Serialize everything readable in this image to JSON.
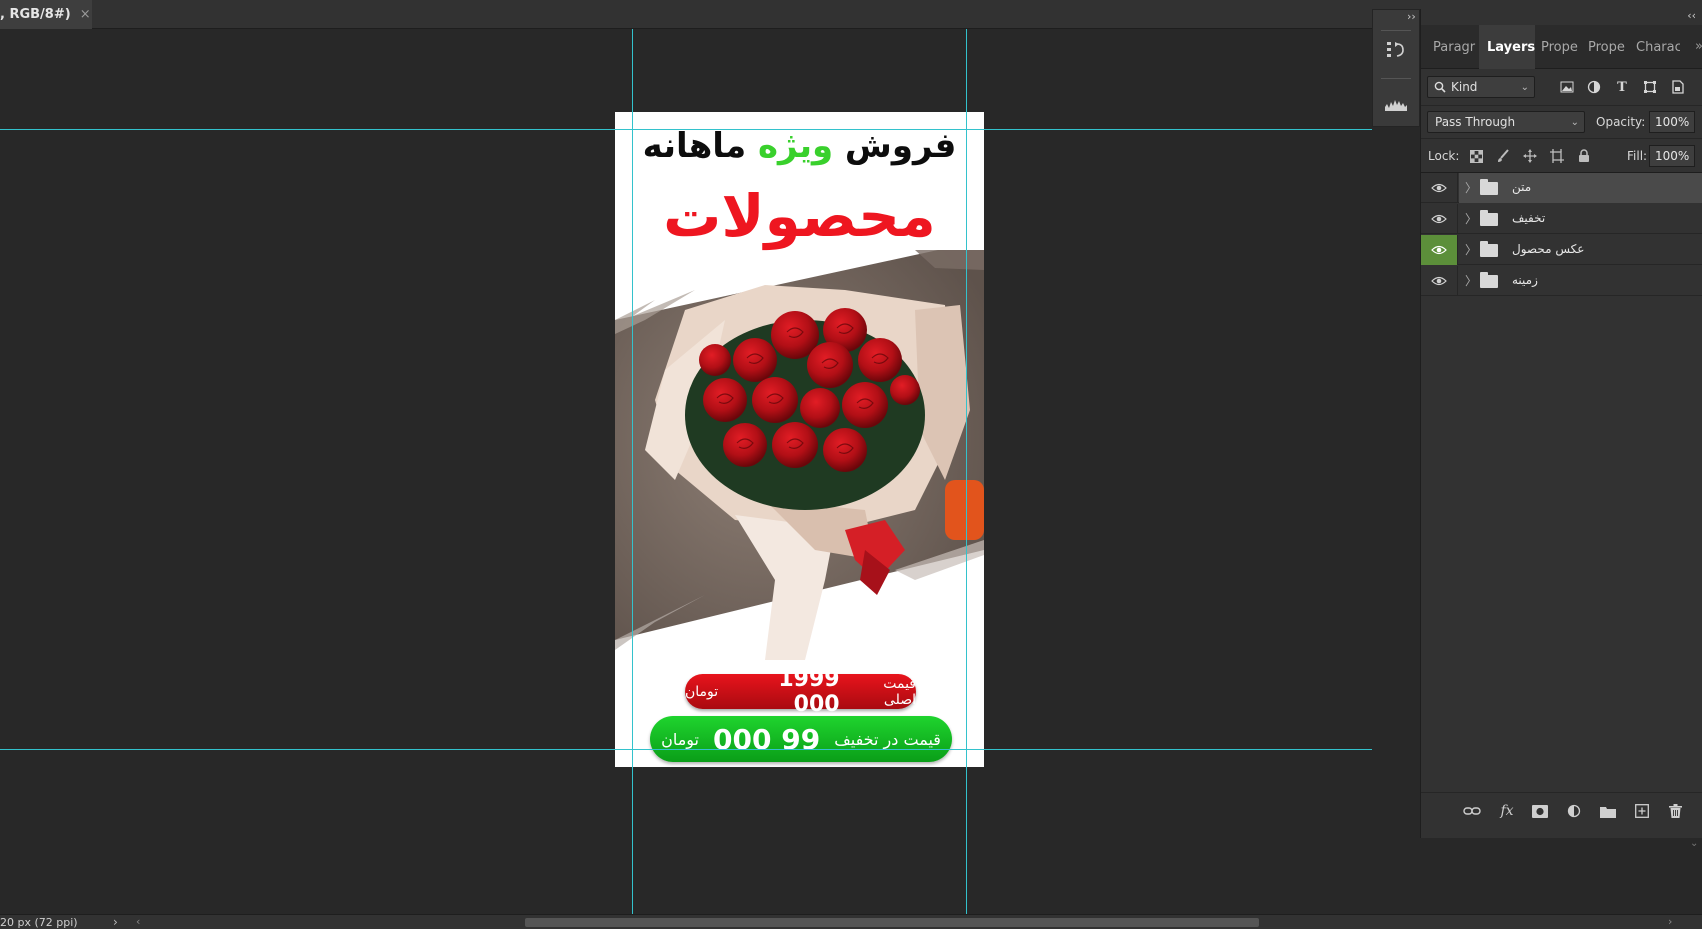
{
  "document_tab": {
    "title": ", RGB/8#)",
    "close": "×"
  },
  "artboard": {
    "headline_part1": "فروش ",
    "headline_accent": "ویژه",
    "headline_part2": " ماهانه",
    "subhead": "محصولات",
    "original_price_label": "قیمت اصلی",
    "original_price_value": "1999 000",
    "original_price_currency": "تومان",
    "discount_price_label": "قیمت در تخفیف",
    "discount_price_value": "99 000",
    "discount_price_currency": "تومان"
  },
  "colors": {
    "headline": "#0d0d0d",
    "accent_green": "#39d02c",
    "subhead_red": "#ee1620",
    "guide": "#33c2cc",
    "visibility_highlight": "#5c8f3a"
  },
  "mini_dock": {
    "collapse": "››",
    "buttons": [
      "history-icon",
      "histogram-icon"
    ]
  },
  "panel": {
    "collapse": "‹‹",
    "tabs": [
      "Paragr",
      "Layers",
      "Prope",
      "Prope",
      "Charac"
    ],
    "tab_more": "»",
    "active_tab": "Layers",
    "filter": {
      "kind_label": "Kind",
      "icons": [
        "image-filter-icon",
        "adjustment-filter-icon",
        "type-filter-icon",
        "shape-filter-icon",
        "smart-object-filter-icon"
      ]
    },
    "blend_mode": "Pass Through",
    "opacity_label": "Opacity:",
    "opacity_value": "100%",
    "lock_label": "Lock:",
    "fill_label": "Fill:",
    "fill_value": "100%",
    "layers": [
      {
        "name": "متن",
        "visible": true,
        "selected": true,
        "eye_highlight": false
      },
      {
        "name": "تخفیف",
        "visible": true,
        "selected": false,
        "eye_highlight": false
      },
      {
        "name": "عکس محصول",
        "visible": true,
        "selected": false,
        "eye_highlight": true
      },
      {
        "name": "زمینه",
        "visible": true,
        "selected": false,
        "eye_highlight": false
      }
    ],
    "footer_icons": [
      "link-layers-icon",
      "fx-icon",
      "add-mask-icon",
      "adjustment-layer-icon",
      "new-group-icon",
      "new-layer-icon",
      "delete-layer-icon"
    ]
  },
  "status": {
    "text": "20 px (72 ppi)"
  }
}
